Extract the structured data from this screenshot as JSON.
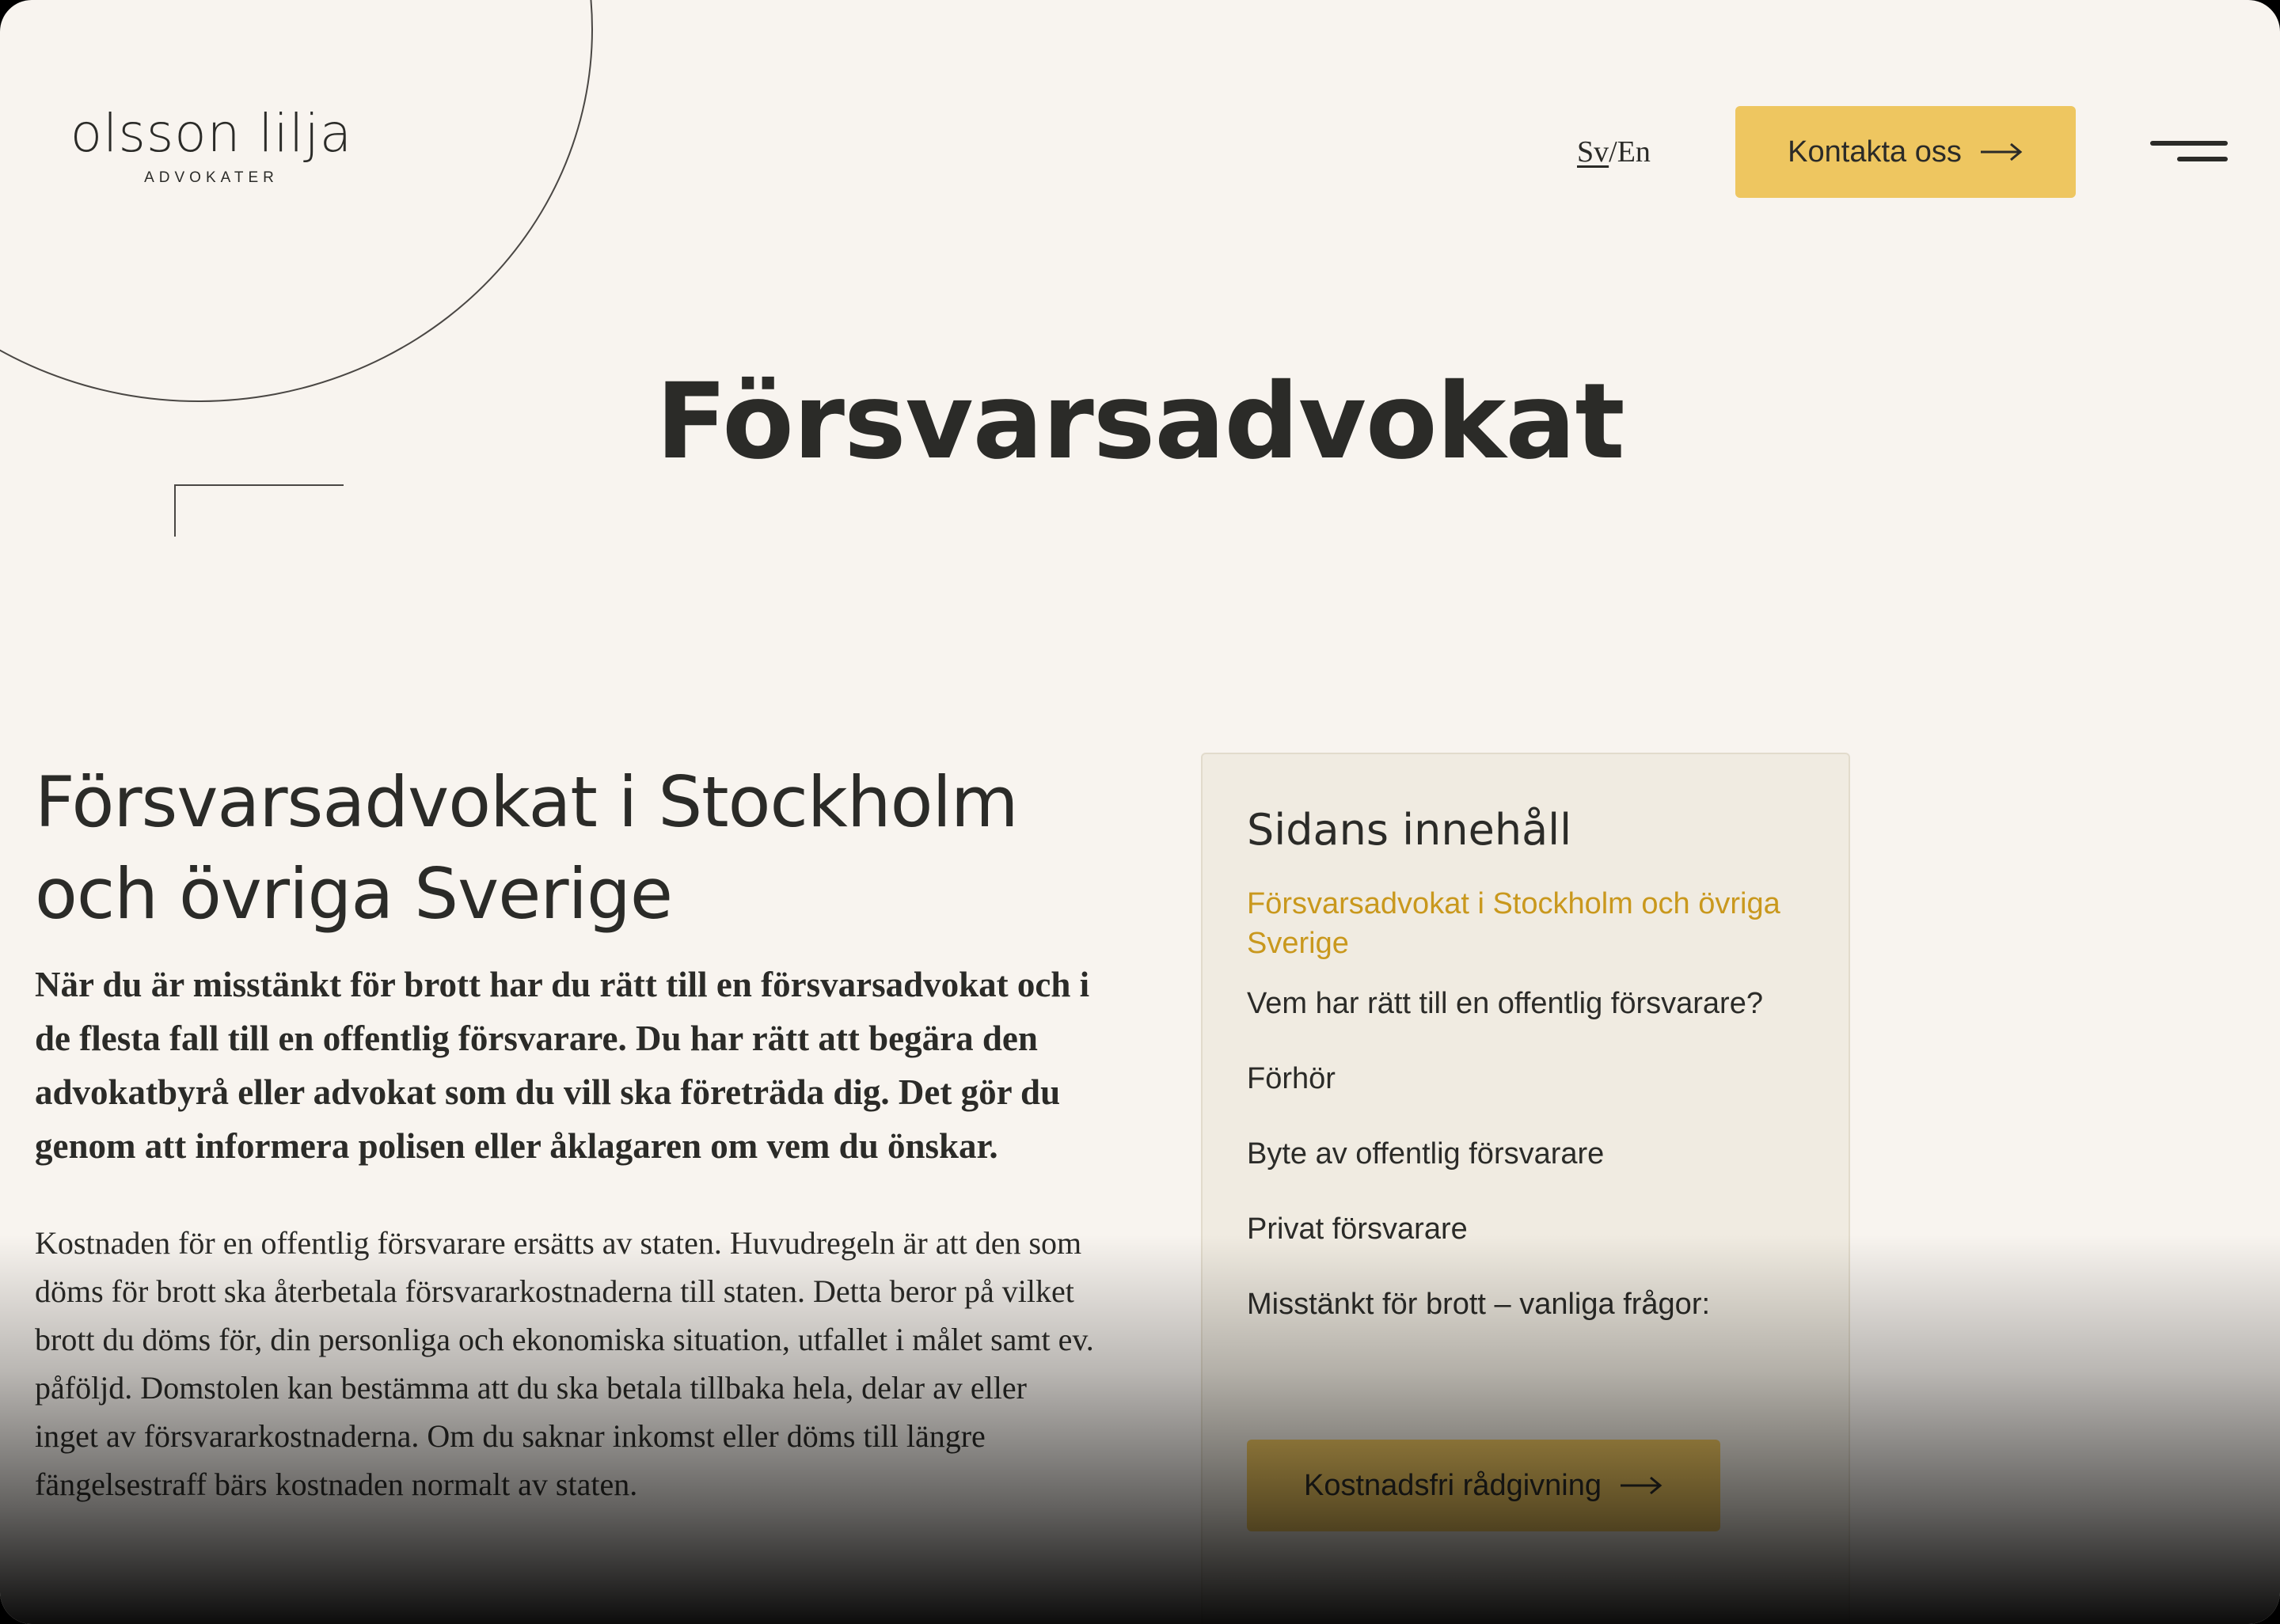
{
  "header": {
    "logo_name": "olsson lilja",
    "logo_sub": "ADVOKATER",
    "lang_sv": "Sv",
    "lang_sep": "/",
    "lang_en": "En",
    "contact_label": "Kontakta oss"
  },
  "page_title": "Försvarsadvokat",
  "article": {
    "heading": "Försvarsadvokat i Stockholm och övriga Sverige",
    "lead": "När du är misstänkt för brott har du rätt till en försvarsadvokat och i de flesta fall till en offentlig försvarare. Du har rätt att begära den advokatbyrå eller advokat som du vill ska företräda dig. Det gör du genom att informera polisen eller åklagaren om vem du önskar.",
    "body": "Kostnaden för en offentlig försvarare ersätts av staten. Huvudregeln är att den som döms för brott ska återbetala försvararkostnaderna till staten. Detta beror på vilket brott du döms för, din personliga och ekonomiska situation, utfallet i målet samt ev. påföljd. Domstolen kan bestämma att du ska betala tillbaka hela, delar av eller inget av försvararkostnaderna. Om du saknar inkomst eller döms till längre fängelsestraff bärs kostnaden normalt av staten."
  },
  "toc": {
    "title": "Sidans innehåll",
    "items": [
      {
        "label": "Försvarsadvokat i Stockholm och övriga Sverige"
      },
      {
        "label": "Vem har rätt till en offentlig försvarare?"
      },
      {
        "label": "Förhör"
      },
      {
        "label": "Byte av offentlig försvarare"
      },
      {
        "label": "Privat försvarare"
      },
      {
        "label": "Misstänkt för brott – vanliga frågor:"
      }
    ],
    "active_index": 0,
    "cta_label": "Kostnadsfri rådgivning"
  },
  "colors": {
    "background": "#f8f4ef",
    "accent": "#eec660",
    "active_link": "#c9981d",
    "text": "#2b2b28",
    "toc_bg": "#f0ebe1"
  },
  "icons": {
    "contact_arrow": "arrow-right-icon",
    "menu": "hamburger-menu-icon",
    "cta_arrow": "arrow-right-icon"
  }
}
